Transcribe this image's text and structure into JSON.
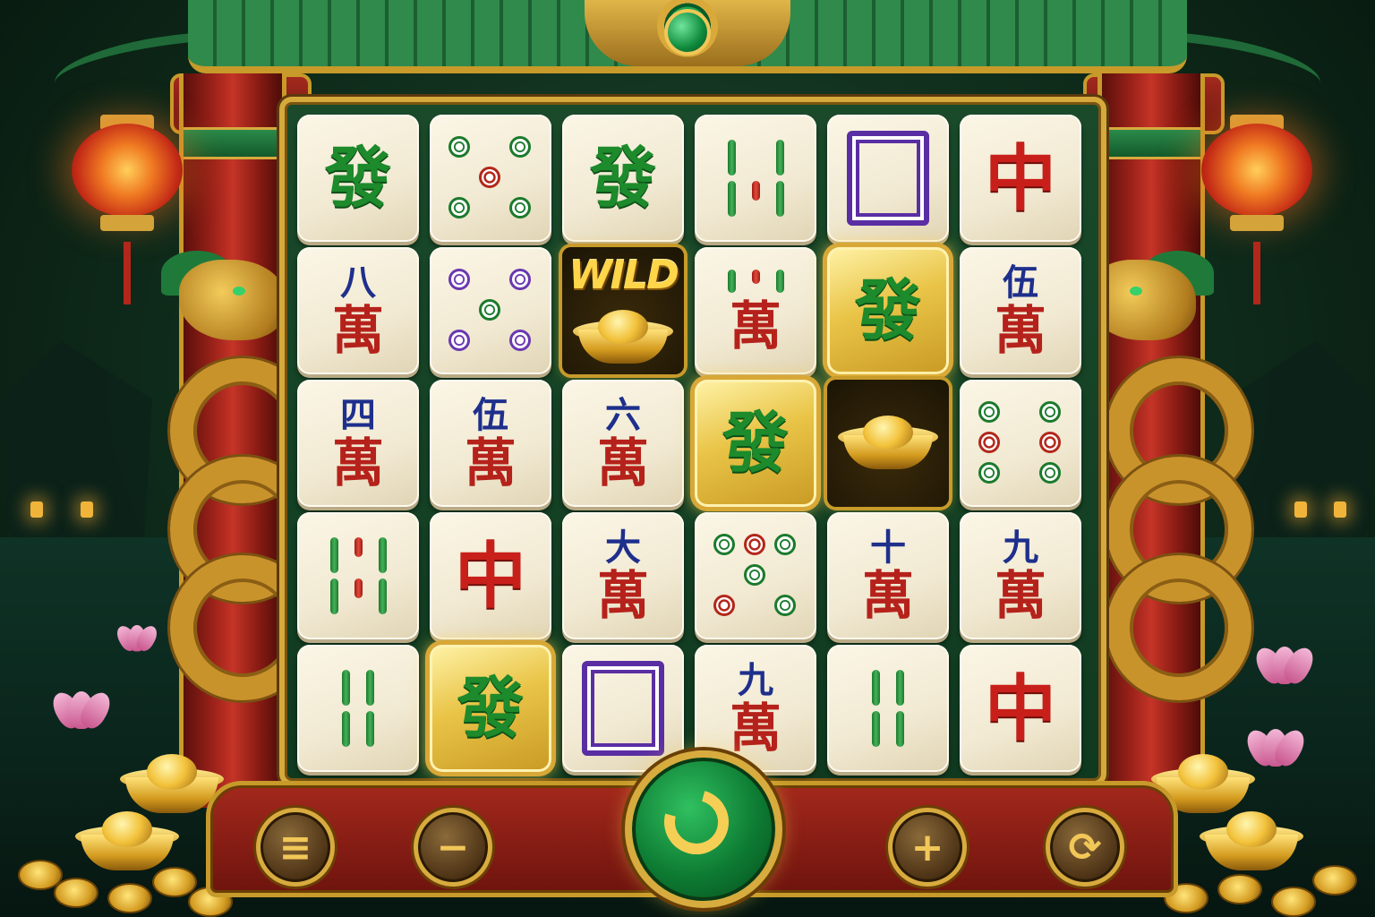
{
  "game": {
    "colors": {
      "board_bg": "#103a20",
      "frame_gold": "#d6a93c",
      "tile_face": "#f4edd8",
      "accent_red": "#c81f1a",
      "accent_green": "#1d8a2c"
    },
    "wild_label": "WILD",
    "grid_rows": [
      [
        {
          "kind": "green",
          "text": "發",
          "gold": false
        },
        {
          "kind": "dots5",
          "gold": false
        },
        {
          "kind": "green",
          "text": "發",
          "gold": false
        },
        {
          "kind": "bamboo5",
          "gold": false
        },
        {
          "kind": "white",
          "gold": false
        },
        {
          "kind": "red",
          "text": "中",
          "gold": false
        }
      ],
      [
        {
          "kind": "wan",
          "num": "八",
          "char": "萬"
        },
        {
          "kind": "dots5p",
          "gold": false
        },
        {
          "kind": "wild"
        },
        {
          "kind": "wan",
          "num": "",
          "char": "萬",
          "top": "bamboo"
        },
        {
          "kind": "green",
          "text": "發",
          "gold": true
        },
        {
          "kind": "wan",
          "num": "伍",
          "char": "萬"
        }
      ],
      [
        {
          "kind": "wan",
          "num": "四",
          "char": "萬"
        },
        {
          "kind": "wan",
          "num": "伍",
          "char": "萬"
        },
        {
          "kind": "wan",
          "num": "六",
          "char": "萬"
        },
        {
          "kind": "green",
          "text": "發",
          "gold": true
        },
        {
          "kind": "ingot"
        },
        {
          "kind": "dots6",
          "gold": false
        }
      ],
      [
        {
          "kind": "bamboo6",
          "gold": false
        },
        {
          "kind": "red",
          "text": "中",
          "gold": false
        },
        {
          "kind": "wan",
          "num": "大",
          "char": "萬"
        },
        {
          "kind": "dots6b",
          "gold": false
        },
        {
          "kind": "wan",
          "num": "十",
          "char": "萬"
        },
        {
          "kind": "wan",
          "num": "九",
          "char": "萬"
        }
      ],
      [
        {
          "kind": "bamboo4",
          "gold": false
        },
        {
          "kind": "green",
          "text": "發",
          "gold": true
        },
        {
          "kind": "white",
          "gold": false
        },
        {
          "kind": "wan",
          "num": "九",
          "char": "萬"
        },
        {
          "kind": "bamboo4",
          "gold": false
        },
        {
          "kind": "red",
          "text": "中",
          "gold": false
        }
      ]
    ],
    "controls": {
      "menu_icon": "menu-icon",
      "minus_icon": "minus-icon",
      "spin_icon": "spin-icon",
      "plus_icon": "plus-icon",
      "autoplay_icon": "autoplay-icon",
      "menu_glyph": "≡",
      "minus_glyph": "−",
      "plus_glyph": "+",
      "autoplay_glyph": "⟳"
    }
  }
}
